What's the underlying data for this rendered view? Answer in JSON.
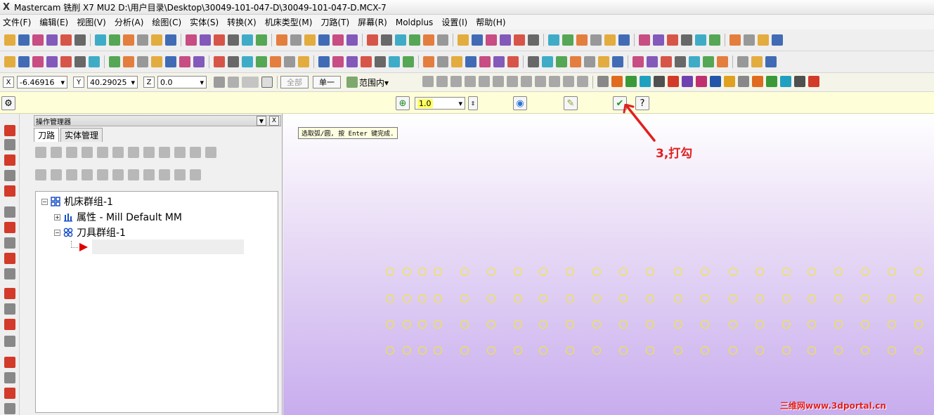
{
  "title": {
    "logo": "X",
    "text": "Mastercam 铣削 X7 MU2  D:\\用户目录\\Desktop\\30049-101-047-D\\30049-101-047-D.MCX-7"
  },
  "menu": [
    "文件(F)",
    "编辑(E)",
    "视图(V)",
    "分析(A)",
    "绘图(C)",
    "实体(S)",
    "转换(X)",
    "机床类型(M)",
    "刀路(T)",
    "屏幕(R)",
    "Moldplus",
    "设置(I)",
    "帮助(H)"
  ],
  "autocursor": {
    "x_label": "X",
    "x_value": "-6.46916",
    "y_label": "Y",
    "y_value": "40.29025",
    "z_label": "Z",
    "z_value": "0.0",
    "all_label": "全部",
    "single_label": "单一",
    "range_value": "范围内"
  },
  "ribbon": {
    "value": "1.0"
  },
  "opmgr": {
    "header": "操作管理器",
    "close": "X",
    "tab_toolpath": "刀路",
    "tab_solids": "实体管理",
    "tree": {
      "machine_group": "机床群组-1",
      "properties": "属性 - Mill Default MM",
      "tool_group": "刀具群组-1"
    }
  },
  "viewport": {
    "prompt": "选取弧/圆, 按 Enter 键完成.",
    "annotation": "3,打勾",
    "watermark": "三维网www.3dportal.cn",
    "circle_color": "#f2ec1e",
    "annotation_color": "#e02020"
  }
}
